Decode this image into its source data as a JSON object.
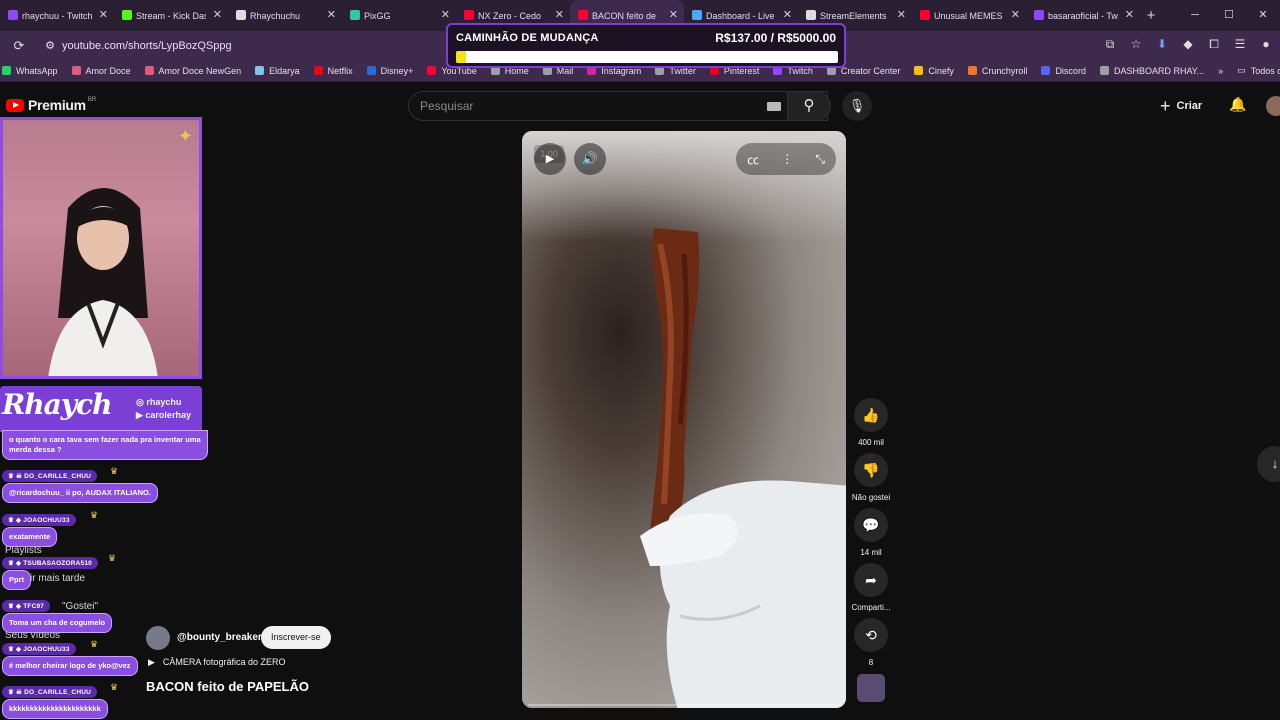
{
  "browser": {
    "tabs": [
      {
        "title": "rhaychuu - Twitch",
        "color": "#9146ff"
      },
      {
        "title": "Stream - Kick Dash",
        "color": "#53fc18"
      },
      {
        "title": "Rhaychuchu",
        "color": "#dddddd"
      },
      {
        "title": "PixGG",
        "color": "#2ecc9b"
      },
      {
        "title": "NX Zero - Cedo",
        "color": "#ff0033"
      },
      {
        "title": "BACON feito de",
        "color": "#ff0033"
      },
      {
        "title": "Dashboard - Live",
        "color": "#4da6ff"
      },
      {
        "title": "StreamElements",
        "color": "#dddddd"
      },
      {
        "title": "Unusual MEMES",
        "color": "#ff0033"
      },
      {
        "title": "basaraoficial - Tw",
        "color": "#9146ff"
      }
    ],
    "active_tab_index": 5,
    "new_tab": "+",
    "url": "youtube.com/shorts/LypBozQSppg",
    "bookmarks": [
      {
        "label": "WhatsApp",
        "color": "#25d366"
      },
      {
        "label": "Amor Doce",
        "color": "#e05a7a"
      },
      {
        "label": "Amor Doce NewGen",
        "color": "#e05a7a"
      },
      {
        "label": "Eldarya",
        "color": "#7fc7e8"
      },
      {
        "label": "Netflix",
        "color": "#e50914"
      },
      {
        "label": "Disney+",
        "color": "#2a6cd6"
      },
      {
        "label": "YouTube",
        "color": "#ff0033"
      },
      {
        "label": "Home",
        "color": "#9aa0a6"
      },
      {
        "label": "Mail",
        "color": "#9aa0a6"
      },
      {
        "label": "Instagram",
        "color": "#d6249f"
      },
      {
        "label": "Twitter",
        "color": "#9aa0a6"
      },
      {
        "label": "Pinterest",
        "color": "#e60023"
      },
      {
        "label": "Twitch",
        "color": "#9146ff"
      },
      {
        "label": "Creator Center",
        "color": "#9aa0a6"
      },
      {
        "label": "Cinefy",
        "color": "#f4c20d"
      },
      {
        "label": "Crunchyroll",
        "color": "#f47521"
      },
      {
        "label": "Discord",
        "color": "#5865f2"
      },
      {
        "label": "DASHBOARD RHAY...",
        "color": "#9aa0a6"
      }
    ],
    "more_bookmarks": "»",
    "all_favorites": "Todos os fav"
  },
  "goal": {
    "title": "CAMINHÃO DE MUDANÇA",
    "amount": "R$137.00 / R$5000.00",
    "progress": 0.0274
  },
  "youtube": {
    "logo_text": "Premium",
    "country": "BR",
    "search_placeholder": "Pesquisar",
    "create_label": "Criar"
  },
  "overlay": {
    "logo": "Rhaych",
    "handles": [
      "rhaychu",
      "carolerhay"
    ]
  },
  "chat": [
    {
      "name": "",
      "message": "o quanto o cara tava sem fazer nada pra inventar uma merda dessa ?"
    },
    {
      "name": "DO_CARILLE_CHUU",
      "message": "@ricardochuu_ ii po, AUDAX ITALIANO."
    },
    {
      "name": "JOAOCHUU33",
      "message": "exatamente"
    },
    {
      "name": "TSUBASAOZORA510",
      "message": "Pprt"
    },
    {
      "name": "TFC97",
      "message": "Toma um cha de cogumelo"
    },
    {
      "name": "JOAOCHUU33",
      "message": "é melhor cheirar logo de yko@vez"
    },
    {
      "name": "DO_CARILLE_CHUU",
      "message": "kkkkkkkkkkkkkkkkkkkkkk"
    }
  ],
  "ghost_menu": [
    "Playlists",
    "ir mais tarde",
    "\"Gostei\"",
    "Seus vídeos"
  ],
  "player": {
    "speed": "1.00",
    "progress": 0.0
  },
  "actions": {
    "like_count": "400 mil",
    "dislike_label": "Não gostei",
    "comment_count": "14 mil",
    "share_label": "Comparti...",
    "remix_count": "8"
  },
  "short": {
    "channel": "@bounty_breaker",
    "subscribe_label": "Inscrever-se",
    "description": "CÂMERA fotográfica do ZERO",
    "title": "BACON feito de PAPELÃO"
  }
}
